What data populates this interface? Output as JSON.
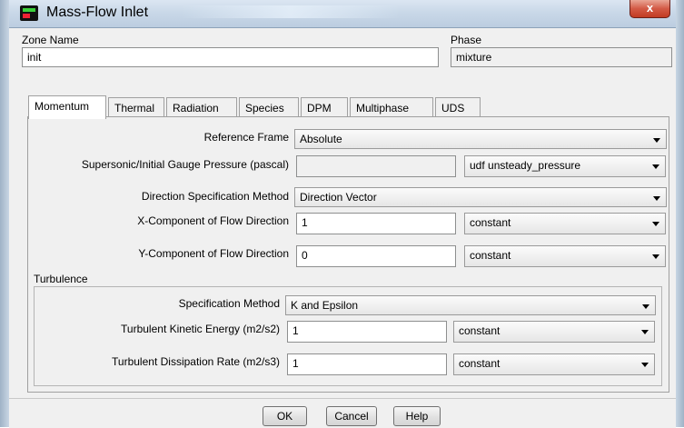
{
  "window": {
    "title": "Mass-Flow Inlet",
    "close_label": "x"
  },
  "zone": {
    "label": "Zone Name",
    "value": "init"
  },
  "phase": {
    "label": "Phase",
    "value": "mixture"
  },
  "tabs": [
    "Momentum",
    "Thermal",
    "Radiation",
    "Species",
    "DPM",
    "Multiphase",
    "UDS"
  ],
  "active_tab": "Momentum",
  "momentum": {
    "reference_frame": {
      "label": "Reference Frame",
      "value": "Absolute"
    },
    "pressure": {
      "label": "Supersonic/Initial Gauge Pressure (pascal)",
      "value": "",
      "method": "udf unsteady_pressure"
    },
    "direction_method": {
      "label": "Direction Specification Method",
      "value": "Direction Vector"
    },
    "x_component": {
      "label": "X-Component of Flow Direction",
      "value": "1",
      "method": "constant"
    },
    "y_component": {
      "label": "Y-Component of Flow Direction",
      "value": "0",
      "method": "constant"
    }
  },
  "turbulence": {
    "title": "Turbulence",
    "spec_method": {
      "label": "Specification Method",
      "value": "K and Epsilon"
    },
    "kinetic_energy": {
      "label": "Turbulent Kinetic Energy (m2/s2)",
      "value": "1",
      "method": "constant"
    },
    "dissipation_rate": {
      "label": "Turbulent Dissipation Rate (m2/s3)",
      "value": "1",
      "method": "constant"
    }
  },
  "buttons": {
    "ok": "OK",
    "cancel": "Cancel",
    "help": "Help"
  }
}
